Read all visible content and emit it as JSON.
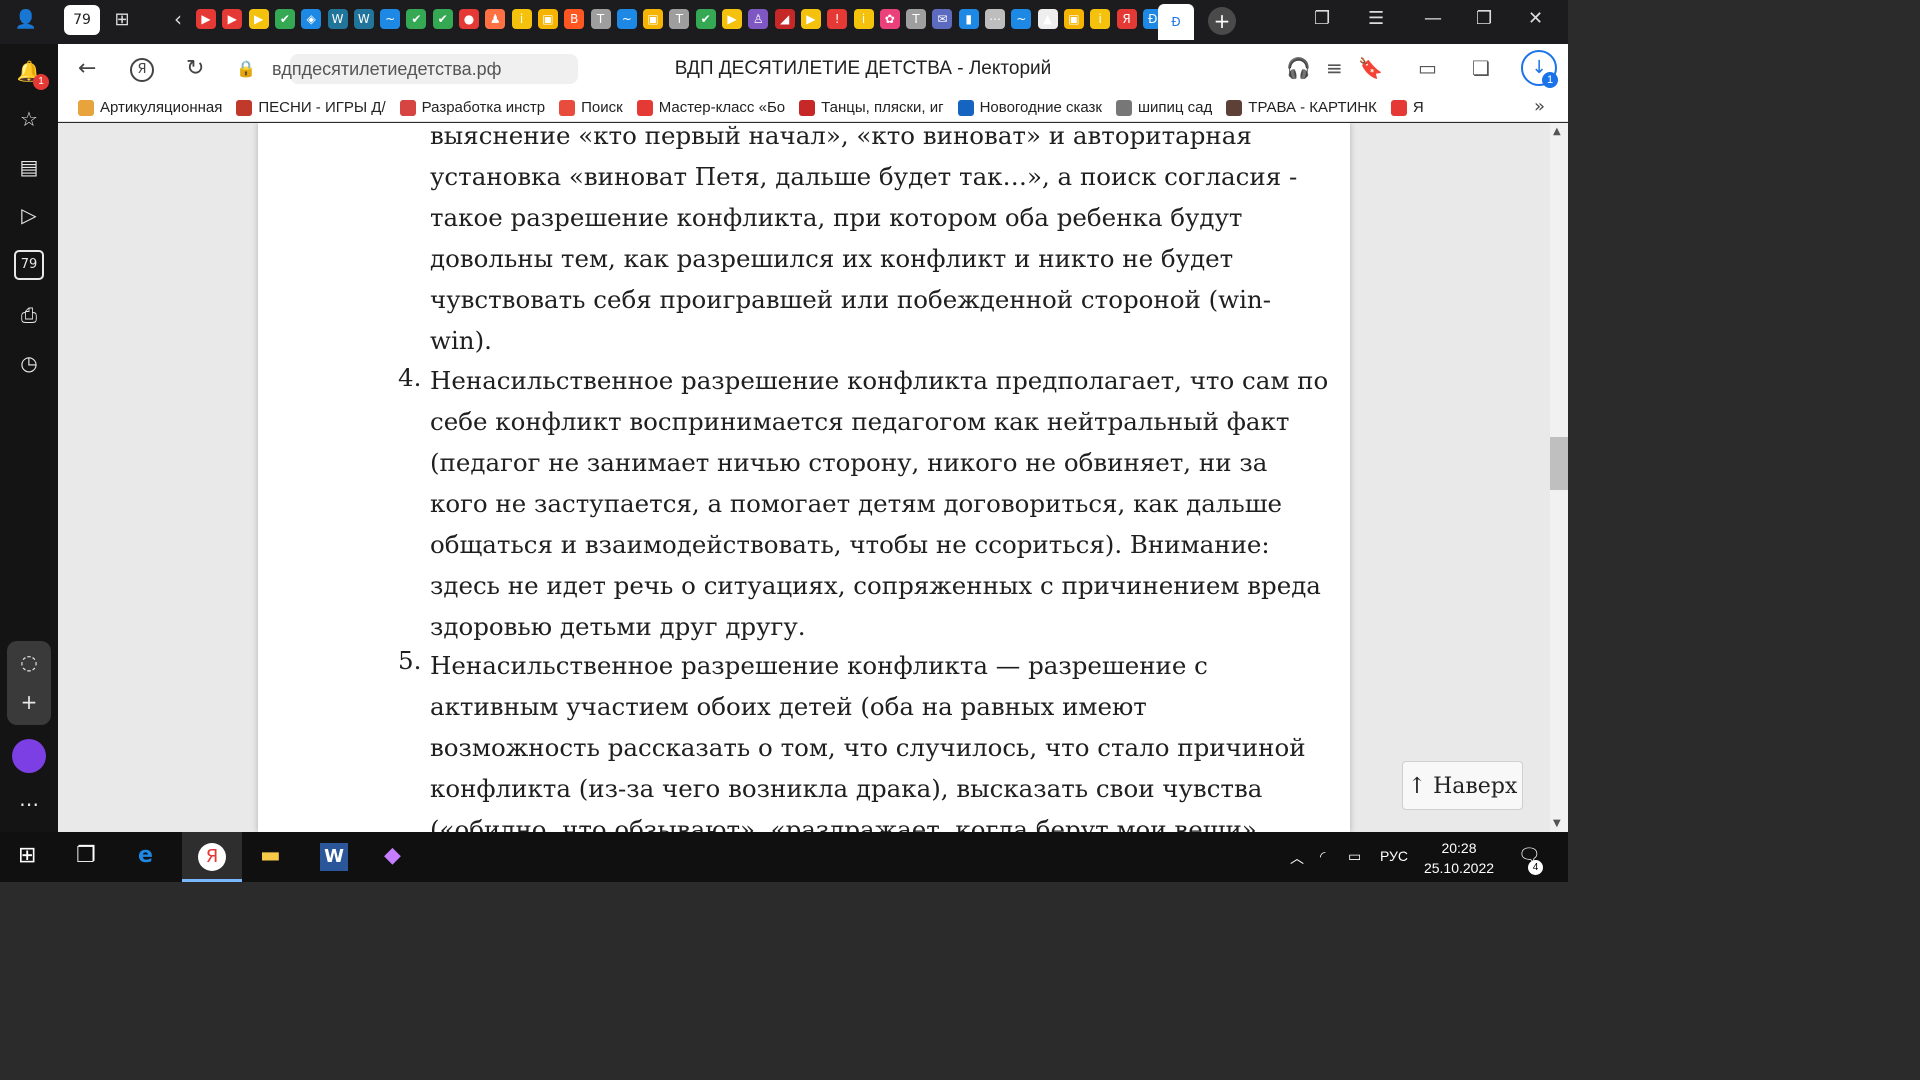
{
  "tabs": {
    "counter_label": "79",
    "icons": [
      "youtube-icon",
      "youtube-icon",
      "play-icon",
      "check-icon",
      "shield-icon",
      "wordpress-icon",
      "wordpress-icon",
      "feather-icon",
      "check-icon",
      "check-icon",
      "apple-icon",
      "figure-icon",
      "info-icon",
      "image-icon",
      "blogger-icon",
      "telegram-icon",
      "feather-icon",
      "image-icon",
      "telegram-icon",
      "check-icon",
      "play-icon",
      "person-icon",
      "car-icon",
      "play-icon",
      "bell-icon",
      "info-icon",
      "flower-icon",
      "telegram-icon",
      "mail-icon",
      "chat-icon",
      "dots-icon",
      "feather-icon",
      "mountain-icon",
      "image-icon",
      "info-icon",
      "yandex-icon",
      "translate-icon"
    ],
    "new_tab": "+"
  },
  "addressbar": {
    "url": "вдпдесятилетиедетства.рф",
    "title": "ВДП ДЕСЯТИЛЕТИЕ ДЕТСТВА - Лекторий",
    "download_badge": "1"
  },
  "bookmarks": [
    {
      "label": "Артикуляционная",
      "color": "#e8a33c"
    },
    {
      "label": "ПЕСНИ - ИГРЫ Д/",
      "color": "#c0392b"
    },
    {
      "label": "Разработка инстр",
      "color": "#d64541"
    },
    {
      "label": "Поиск",
      "color": "#e74c3c"
    },
    {
      "label": "Мастер-класс «Бо",
      "color": "#e53935"
    },
    {
      "label": "Танцы, пляски, иг",
      "color": "#c62828"
    },
    {
      "label": "Новогодние сказк",
      "color": "#1565c0"
    },
    {
      "label": "шипиц сад",
      "color": "#777777"
    },
    {
      "label": "ТРАВА - КАРТИНК",
      "color": "#5d4037"
    },
    {
      "label": "Я",
      "color": "#e53935"
    }
  ],
  "sidebar": {
    "notification_badge": "1",
    "counter_label": "79"
  },
  "article": {
    "lines_item3": [
      "выяснение «кто первый начал», «кто виноват» и авторитарная",
      "установка «виноват Петя, дальше будет так…», а поиск согласия -",
      "такое разрешение конфликта, при котором оба ребенка будут",
      "довольны тем, как разрешился их конфликт и никто не будет",
      "чувствовать себя проигравшей или побежденной стороной (win-",
      "win)."
    ],
    "item4_number": "4.",
    "lines_item4": [
      "Ненасильственное разрешение конфликта предполагает, что сам по",
      "себе конфликт воспринимается педагогом как нейтральный факт",
      "(педагог не занимает ничью сторону, никого не обвиняет, ни за",
      "кого не заступается, а помогает детям договориться, как дальше",
      "общаться и взаимодействовать, чтобы не ссориться). Внимание:",
      "здесь не идет речь о ситуациях, сопряженных с причинением вреда",
      "здоровью детьми друг другу."
    ],
    "item5_number": "5.",
    "lines_item5": [
      "Ненасильственное разрешение конфликта — разрешение с",
      "активным участием обоих детей (оба на равных имеют",
      "возможность рассказать о том, что случилось, что стало причиной",
      "конфликта (из-за чего возникла драка), высказать свои чувства",
      "(«обидно, что обзывают», «раздражает, когда берут мои вещи»"
    ],
    "top_button": "↑ Наверх"
  },
  "taskbar": {
    "language": "РУС",
    "time": "20:28",
    "date": "25.10.2022",
    "notifications": "4"
  }
}
